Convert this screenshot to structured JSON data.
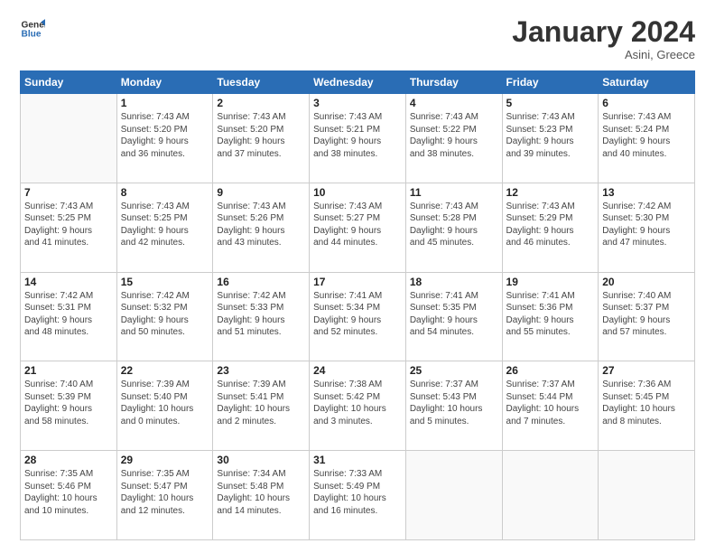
{
  "logo": {
    "line1": "General",
    "line2": "Blue"
  },
  "title": "January 2024",
  "subtitle": "Asini, Greece",
  "days_header": [
    "Sunday",
    "Monday",
    "Tuesday",
    "Wednesday",
    "Thursday",
    "Friday",
    "Saturday"
  ],
  "weeks": [
    [
      {
        "num": "",
        "info": ""
      },
      {
        "num": "1",
        "info": "Sunrise: 7:43 AM\nSunset: 5:20 PM\nDaylight: 9 hours\nand 36 minutes."
      },
      {
        "num": "2",
        "info": "Sunrise: 7:43 AM\nSunset: 5:20 PM\nDaylight: 9 hours\nand 37 minutes."
      },
      {
        "num": "3",
        "info": "Sunrise: 7:43 AM\nSunset: 5:21 PM\nDaylight: 9 hours\nand 38 minutes."
      },
      {
        "num": "4",
        "info": "Sunrise: 7:43 AM\nSunset: 5:22 PM\nDaylight: 9 hours\nand 38 minutes."
      },
      {
        "num": "5",
        "info": "Sunrise: 7:43 AM\nSunset: 5:23 PM\nDaylight: 9 hours\nand 39 minutes."
      },
      {
        "num": "6",
        "info": "Sunrise: 7:43 AM\nSunset: 5:24 PM\nDaylight: 9 hours\nand 40 minutes."
      }
    ],
    [
      {
        "num": "7",
        "info": "Sunrise: 7:43 AM\nSunset: 5:25 PM\nDaylight: 9 hours\nand 41 minutes."
      },
      {
        "num": "8",
        "info": "Sunrise: 7:43 AM\nSunset: 5:25 PM\nDaylight: 9 hours\nand 42 minutes."
      },
      {
        "num": "9",
        "info": "Sunrise: 7:43 AM\nSunset: 5:26 PM\nDaylight: 9 hours\nand 43 minutes."
      },
      {
        "num": "10",
        "info": "Sunrise: 7:43 AM\nSunset: 5:27 PM\nDaylight: 9 hours\nand 44 minutes."
      },
      {
        "num": "11",
        "info": "Sunrise: 7:43 AM\nSunset: 5:28 PM\nDaylight: 9 hours\nand 45 minutes."
      },
      {
        "num": "12",
        "info": "Sunrise: 7:43 AM\nSunset: 5:29 PM\nDaylight: 9 hours\nand 46 minutes."
      },
      {
        "num": "13",
        "info": "Sunrise: 7:42 AM\nSunset: 5:30 PM\nDaylight: 9 hours\nand 47 minutes."
      }
    ],
    [
      {
        "num": "14",
        "info": "Sunrise: 7:42 AM\nSunset: 5:31 PM\nDaylight: 9 hours\nand 48 minutes."
      },
      {
        "num": "15",
        "info": "Sunrise: 7:42 AM\nSunset: 5:32 PM\nDaylight: 9 hours\nand 50 minutes."
      },
      {
        "num": "16",
        "info": "Sunrise: 7:42 AM\nSunset: 5:33 PM\nDaylight: 9 hours\nand 51 minutes."
      },
      {
        "num": "17",
        "info": "Sunrise: 7:41 AM\nSunset: 5:34 PM\nDaylight: 9 hours\nand 52 minutes."
      },
      {
        "num": "18",
        "info": "Sunrise: 7:41 AM\nSunset: 5:35 PM\nDaylight: 9 hours\nand 54 minutes."
      },
      {
        "num": "19",
        "info": "Sunrise: 7:41 AM\nSunset: 5:36 PM\nDaylight: 9 hours\nand 55 minutes."
      },
      {
        "num": "20",
        "info": "Sunrise: 7:40 AM\nSunset: 5:37 PM\nDaylight: 9 hours\nand 57 minutes."
      }
    ],
    [
      {
        "num": "21",
        "info": "Sunrise: 7:40 AM\nSunset: 5:39 PM\nDaylight: 9 hours\nand 58 minutes."
      },
      {
        "num": "22",
        "info": "Sunrise: 7:39 AM\nSunset: 5:40 PM\nDaylight: 10 hours\nand 0 minutes."
      },
      {
        "num": "23",
        "info": "Sunrise: 7:39 AM\nSunset: 5:41 PM\nDaylight: 10 hours\nand 2 minutes."
      },
      {
        "num": "24",
        "info": "Sunrise: 7:38 AM\nSunset: 5:42 PM\nDaylight: 10 hours\nand 3 minutes."
      },
      {
        "num": "25",
        "info": "Sunrise: 7:37 AM\nSunset: 5:43 PM\nDaylight: 10 hours\nand 5 minutes."
      },
      {
        "num": "26",
        "info": "Sunrise: 7:37 AM\nSunset: 5:44 PM\nDaylight: 10 hours\nand 7 minutes."
      },
      {
        "num": "27",
        "info": "Sunrise: 7:36 AM\nSunset: 5:45 PM\nDaylight: 10 hours\nand 8 minutes."
      }
    ],
    [
      {
        "num": "28",
        "info": "Sunrise: 7:35 AM\nSunset: 5:46 PM\nDaylight: 10 hours\nand 10 minutes."
      },
      {
        "num": "29",
        "info": "Sunrise: 7:35 AM\nSunset: 5:47 PM\nDaylight: 10 hours\nand 12 minutes."
      },
      {
        "num": "30",
        "info": "Sunrise: 7:34 AM\nSunset: 5:48 PM\nDaylight: 10 hours\nand 14 minutes."
      },
      {
        "num": "31",
        "info": "Sunrise: 7:33 AM\nSunset: 5:49 PM\nDaylight: 10 hours\nand 16 minutes."
      },
      {
        "num": "",
        "info": ""
      },
      {
        "num": "",
        "info": ""
      },
      {
        "num": "",
        "info": ""
      }
    ]
  ]
}
